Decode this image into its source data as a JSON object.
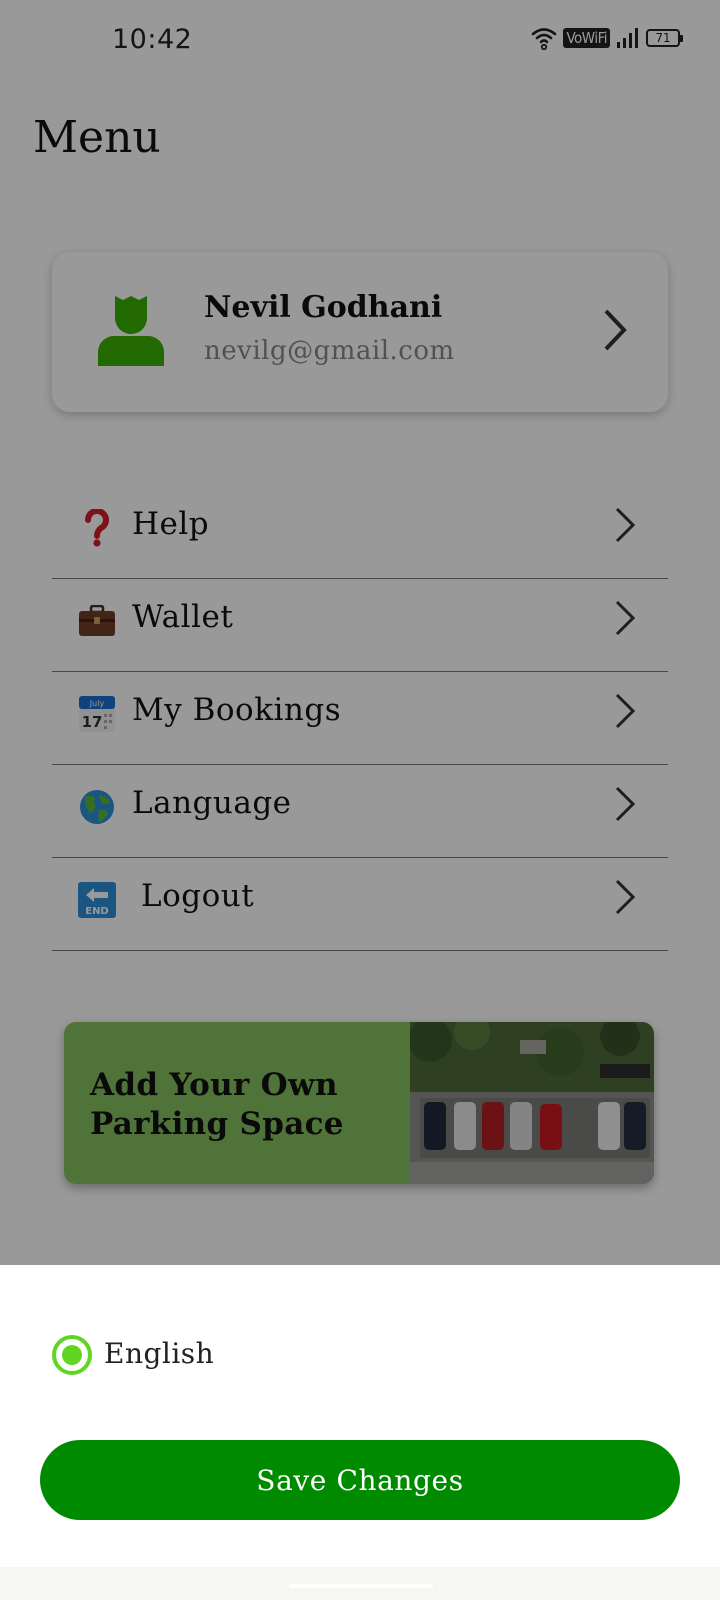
{
  "status_bar": {
    "time": "10:42",
    "network_label": "VoWiFi",
    "battery_level": "71",
    "icons": [
      "wifi-icon",
      "signal-icon",
      "battery-icon"
    ]
  },
  "page": {
    "title": "Menu"
  },
  "profile": {
    "name": "Nevil Godhani",
    "email": "nevilg@gmail.com",
    "avatar_icon": "user-avatar-icon"
  },
  "menu": {
    "items": [
      {
        "label": "Help",
        "icon": "question-icon"
      },
      {
        "label": "Wallet",
        "icon": "briefcase-icon"
      },
      {
        "label": "My Bookings",
        "icon": "calendar-icon",
        "icon_text": {
          "month": "July",
          "day": "17"
        }
      },
      {
        "label": "Language",
        "icon": "globe-icon"
      },
      {
        "label": "Logout",
        "icon": "end-arrow-icon",
        "icon_text": {
          "end": "END"
        }
      }
    ]
  },
  "promo": {
    "line1": "Add Your Own",
    "line2": "Parking Space",
    "image": "parking-lot-aerial-image"
  },
  "language_sheet": {
    "options": [
      {
        "label": "English",
        "selected": true
      }
    ],
    "save_label": "Save Changes"
  },
  "colors": {
    "accent_green": "#008a00",
    "radio_green": "#5fd624",
    "avatar_green": "#38b000",
    "promo_green": "#86c061"
  }
}
